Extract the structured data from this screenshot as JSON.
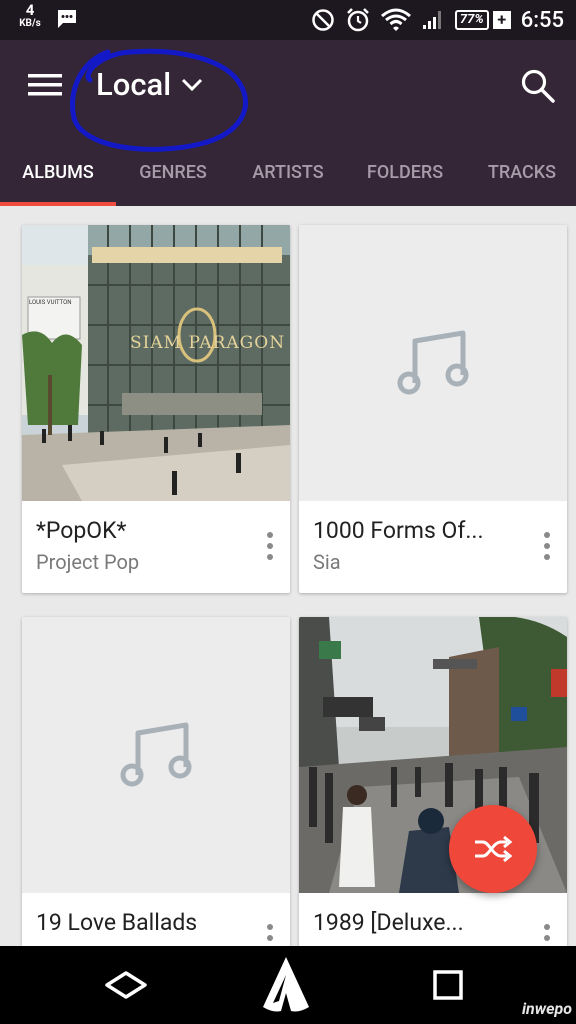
{
  "status": {
    "net_speed": "4",
    "net_unit": "KB/s",
    "battery": "77%",
    "charging": "+",
    "time": "6:55"
  },
  "app_bar": {
    "title": "Local",
    "accent_color": "#352637",
    "indicator_color": "#ef4b3f"
  },
  "tabs": [
    {
      "label": "ALBUMS",
      "active": true
    },
    {
      "label": "GENRES",
      "active": false
    },
    {
      "label": "ARTISTS",
      "active": false
    },
    {
      "label": "FOLDERS",
      "active": false
    },
    {
      "label": "TRACKS",
      "active": false
    }
  ],
  "albums": [
    {
      "title": "*PopOK*",
      "artist": "Project Pop",
      "art": "photo-mall",
      "sign_text": "SIAM PARAGON",
      "store_text": "LOUIS VUITTON"
    },
    {
      "title": "1000 Forms Of...",
      "artist": "Sia",
      "art": "music-note-placeholder"
    },
    {
      "title": "19 Love Ballads",
      "artist": "",
      "art": "music-note-placeholder"
    },
    {
      "title": "1989 [Deluxe...",
      "artist": "",
      "art": "photo-street"
    }
  ],
  "fab": {
    "icon": "shuffle-icon",
    "color": "#f0473b"
  },
  "watermark": "inwepo"
}
